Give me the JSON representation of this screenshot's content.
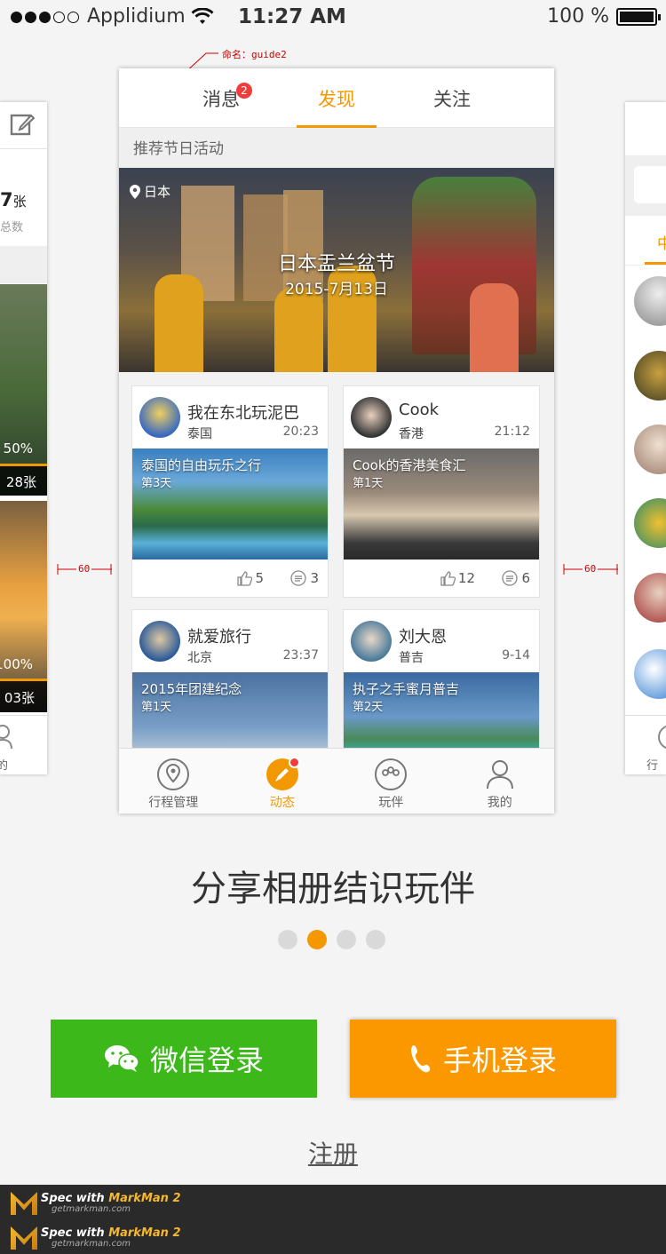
{
  "status_bar": {
    "carrier": "Applidium",
    "time": "11:27 AM",
    "battery": "100 %"
  },
  "annotation": {
    "label": "命名：guide2",
    "left_gap": "60",
    "right_gap": "60"
  },
  "left_preview": {
    "count_value": "7",
    "count_unit": "张",
    "count_label": "总数",
    "progress_1": "50%",
    "photos_1": "28张",
    "progress_2": "100%",
    "photos_2": "03张",
    "nav_label": "的"
  },
  "right_preview": {
    "tab_char": "中",
    "nav_label": "行程"
  },
  "phone": {
    "tabs": [
      {
        "label": "消息",
        "badge": "2"
      },
      {
        "label": "发现"
      },
      {
        "label": "关注"
      }
    ],
    "section_title": "推荐节日活动",
    "banner": {
      "location": "日本",
      "title": "日本盂兰盆节",
      "date": "2015-7月13日"
    },
    "posts": [
      {
        "name": "我在东北玩泥巴",
        "place": "泰国",
        "time": "20:23",
        "photo_title": "泰国的自由玩乐之行",
        "day": "第3天",
        "likes": "5",
        "comments": "3"
      },
      {
        "name": "Cook",
        "place": "香港",
        "time": "21:12",
        "photo_title": "Cook的香港美食汇",
        "day": "第1天",
        "likes": "12",
        "comments": "6"
      },
      {
        "name": "就爱旅行",
        "place": "北京",
        "time": "23:37",
        "photo_title": "2015年团建纪念",
        "day": "第1天"
      },
      {
        "name": "刘大恩",
        "place": "普吉",
        "time": "9-14",
        "photo_title": "执子之手蜜月普吉",
        "day": "第2天"
      }
    ],
    "nav": [
      {
        "label": "行程管理"
      },
      {
        "label": "动态"
      },
      {
        "label": "玩伴"
      },
      {
        "label": "我的"
      }
    ]
  },
  "headline": "分享相册结识玩伴",
  "pager": {
    "total": 4,
    "active": 2
  },
  "buttons": {
    "wechat": "微信登录",
    "phone": "手机登录",
    "register": "注册"
  },
  "watermark": {
    "line1_prefix": "Spec with",
    "line1_brand": "MarkMan 2",
    "line2": "getmarkman.com"
  },
  "colors": {
    "accent": "#f39800",
    "wechat_green": "#3cb81a",
    "phone_orange": "#fb9800",
    "badge_red": "#f03c3c"
  }
}
